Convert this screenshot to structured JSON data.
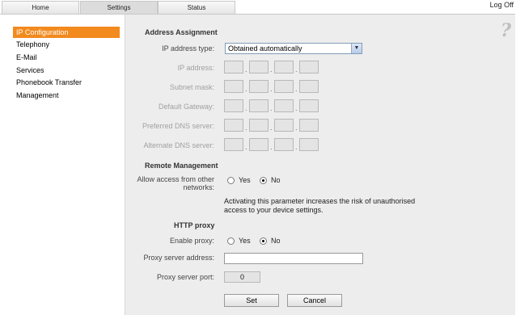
{
  "tabs": [
    {
      "label": "Home"
    },
    {
      "label": "Settings"
    },
    {
      "label": "Status"
    }
  ],
  "logoff_label": "Log Off",
  "sidebar": {
    "items": [
      {
        "label": "IP Configuration",
        "active": true
      },
      {
        "label": "Telephony"
      },
      {
        "label": "E-Mail"
      },
      {
        "label": "Services"
      },
      {
        "label": "Phonebook Transfer"
      },
      {
        "label": "Management"
      }
    ]
  },
  "help_glyph": "?",
  "address_assignment": {
    "heading": "Address Assignment",
    "ip_type_label": "IP address type:",
    "ip_type_value": "Obtained automatically",
    "ip_address_label": "IP address:",
    "subnet_label": "Subnet mask:",
    "gateway_label": "Default Gateway:",
    "preferred_dns_label": "Preferred DNS server:",
    "alternate_dns_label": "Alternate DNS server:",
    "separator": "."
  },
  "remote_management": {
    "heading": "Remote Management",
    "allow_label_line1": "Allow access from other",
    "allow_label_line2": "networks:",
    "yes_label": "Yes",
    "no_label": "No",
    "selected": "No",
    "note_line1": "Activating this parameter increases the risk of unauthorised",
    "note_line2": "access to your device settings."
  },
  "http_proxy": {
    "heading": "HTTP proxy",
    "enable_label": "Enable proxy:",
    "yes_label": "Yes",
    "no_label": "No",
    "selected": "No",
    "server_address_label": "Proxy server address:",
    "server_address_value": "",
    "server_port_label": "Proxy server port:",
    "server_port_value": "0"
  },
  "buttons": {
    "set_label": "Set",
    "cancel_label": "Cancel"
  },
  "colors": {
    "accent": "#f28a1e",
    "panel_bg": "#ededed"
  }
}
